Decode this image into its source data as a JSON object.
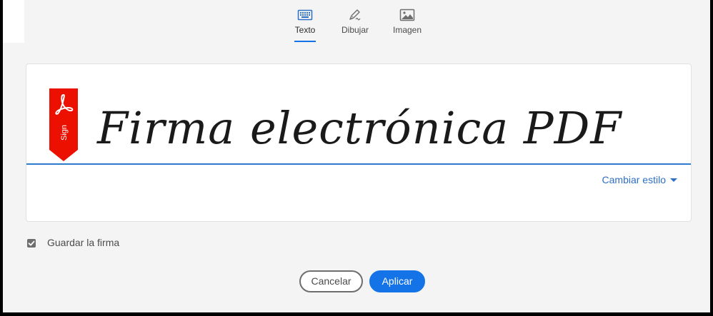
{
  "tabs": [
    {
      "label": "Texto",
      "icon": "keyboard-icon",
      "active": true
    },
    {
      "label": "Dibujar",
      "icon": "pen-draw-icon",
      "active": false
    },
    {
      "label": "Imagen",
      "icon": "image-icon",
      "active": false
    }
  ],
  "signature": {
    "text": "Firma electrónica PDF",
    "ribbon_label": "Sign",
    "ribbon_icon": "acrobat-logo-icon",
    "change_style_label": "Cambiar estilo",
    "underline_color": "#2d7bcb"
  },
  "save_signature": {
    "label": "Guardar la firma",
    "checked": true
  },
  "buttons": {
    "cancel": "Cancelar",
    "apply": "Aplicar"
  },
  "colors": {
    "accent": "#1473e6",
    "ribbon": "#eb1000",
    "background": "#f4f4f4"
  }
}
